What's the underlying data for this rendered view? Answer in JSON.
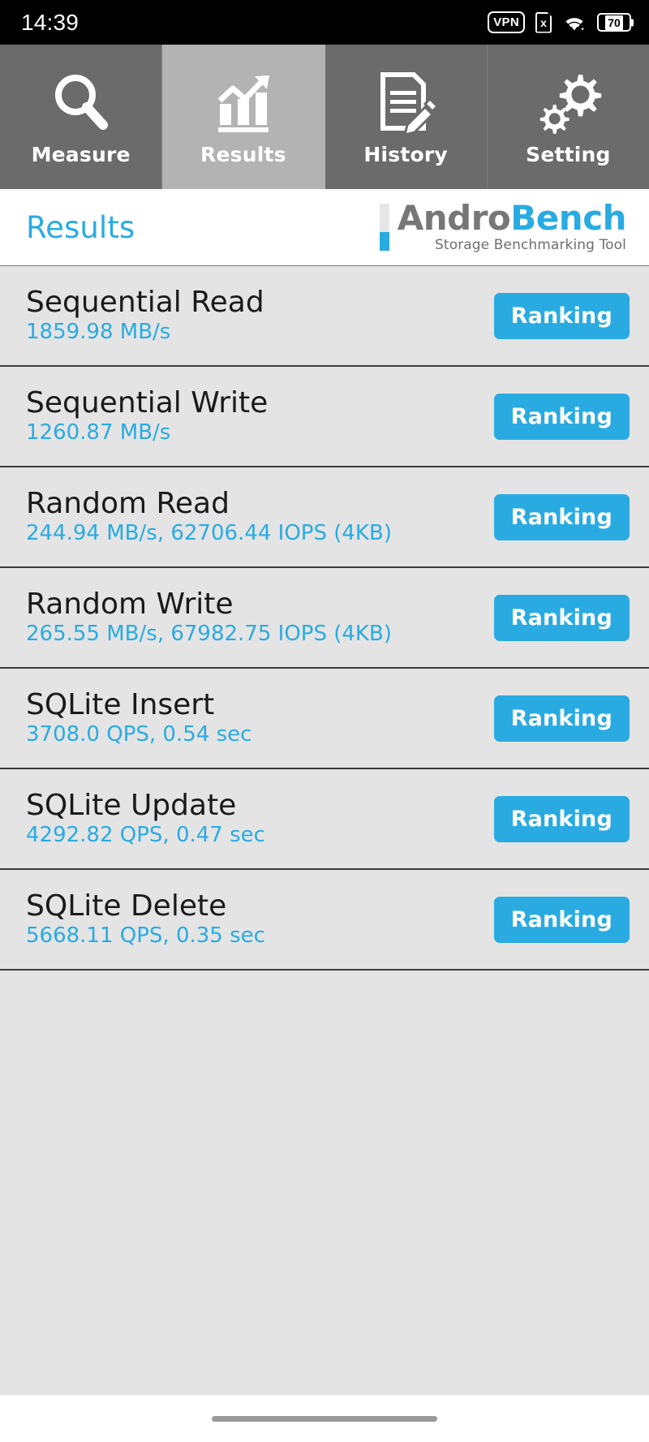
{
  "status_bar": {
    "time": "14:39",
    "vpn_label": "VPN",
    "sim_label": "x",
    "battery_level": "70",
    "icons": [
      "vpn-icon",
      "sim-card-off-icon",
      "wifi-icon",
      "battery-icon"
    ]
  },
  "tabs": [
    {
      "label": "Measure",
      "icon": "magnifier-icon",
      "active": false
    },
    {
      "label": "Results",
      "icon": "bar-chart-icon",
      "active": true
    },
    {
      "label": "History",
      "icon": "document-pencil-icon",
      "active": false
    },
    {
      "label": "Setting",
      "icon": "gears-icon",
      "active": false
    }
  ],
  "header": {
    "title": "Results",
    "brand_first": "Andro",
    "brand_second": "Bench",
    "tagline": "Storage Benchmarking Tool"
  },
  "colors": {
    "accent": "#29ABE2",
    "tab_inactive": "#6b6b6b",
    "tab_active": "#b3b3b3",
    "row_bg": "#e4e4e4",
    "status_bg": "#000000"
  },
  "results": {
    "button_label": "Ranking",
    "rows": [
      {
        "name": "Sequential Read",
        "value": "1859.98 MB/s"
      },
      {
        "name": "Sequential Write",
        "value": "1260.87 MB/s"
      },
      {
        "name": "Random Read",
        "value": "244.94 MB/s, 62706.44 IOPS (4KB)"
      },
      {
        "name": "Random Write",
        "value": "265.55 MB/s, 67982.75 IOPS (4KB)"
      },
      {
        "name": "SQLite Insert",
        "value": "3708.0 QPS, 0.54 sec"
      },
      {
        "name": "SQLite Update",
        "value": "4292.82 QPS, 0.47 sec"
      },
      {
        "name": "SQLite Delete",
        "value": "5668.11 QPS, 0.35 sec"
      }
    ]
  }
}
